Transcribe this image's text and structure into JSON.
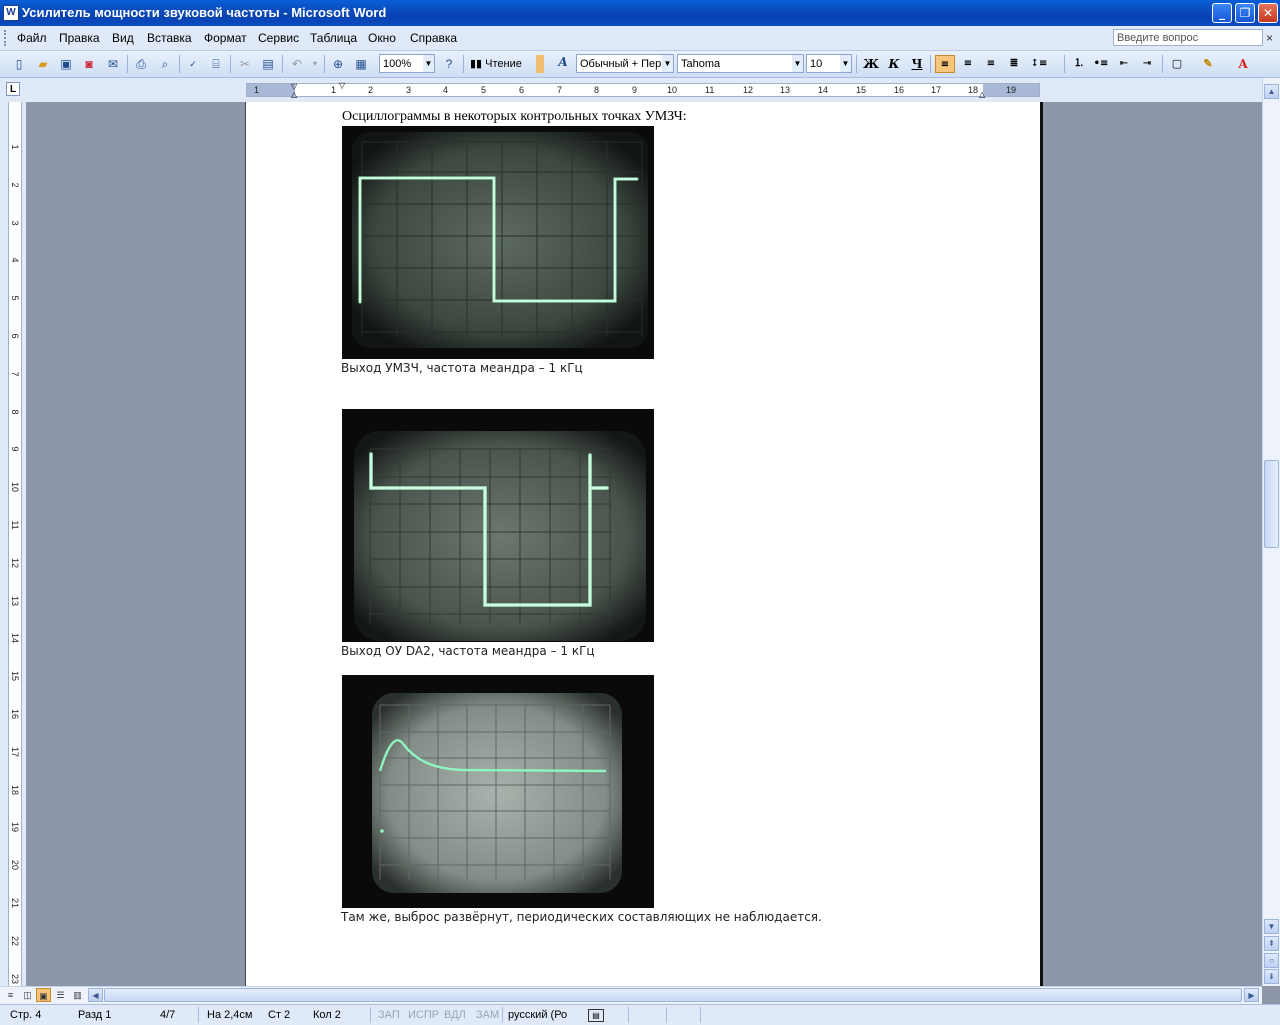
{
  "window": {
    "title": "Усилитель мощности звуковой частоты - Microsoft Word",
    "app_icon": "W",
    "controls": {
      "minimize": "_",
      "restore": "❐",
      "close": "✕"
    }
  },
  "menu": {
    "items": [
      "Файл",
      "Правка",
      "Вид",
      "Вставка",
      "Формат",
      "Сервис",
      "Таблица",
      "Окно",
      "Справка"
    ],
    "ask_placeholder": "Введите вопрос",
    "ask_close": "×"
  },
  "toolbar": {
    "zoom": "100%",
    "reading_label": "Чтение",
    "style": "Обычный + Пер",
    "font": "Tahoma",
    "font_size": "10",
    "bold": "Ж",
    "italic": "К",
    "underline": "Ч"
  },
  "ruler": {
    "corner": "L",
    "numbers": [
      "1",
      "1",
      "2",
      "3",
      "4",
      "5",
      "6",
      "7",
      "8",
      "9",
      "10",
      "11",
      "12",
      "13",
      "14",
      "15",
      "16",
      "17",
      "18",
      "19"
    ],
    "vnumbers": [
      "1",
      "2",
      "3",
      "4",
      "5",
      "6",
      "7",
      "8",
      "9",
      "10",
      "11",
      "12",
      "13",
      "14",
      "15",
      "16",
      "17",
      "18",
      "19",
      "20",
      "21",
      "22",
      "23"
    ]
  },
  "document": {
    "heading": "Осциллограммы в некоторых контрольных точках УМЗЧ:",
    "figures": [
      {
        "caption": "Выход УМЗЧ, частота меандра – 1 кГц"
      },
      {
        "caption": "Выход ОУ DA2, частота меандра – 1 кГц"
      },
      {
        "caption": "Там же, выброс развёрнут, периодических составляющих не наблюдается."
      }
    ]
  },
  "status": {
    "page": "Стр. 4",
    "section": "Разд 1",
    "pages": "4/7",
    "position": "На 2,4см",
    "line": "Ст 2",
    "column": "Кол 2",
    "rec": "ЗАП",
    "trk": "ИСПР",
    "ext": "ВДЛ",
    "ovr": "ЗАМ",
    "language": "русский (Ро"
  }
}
